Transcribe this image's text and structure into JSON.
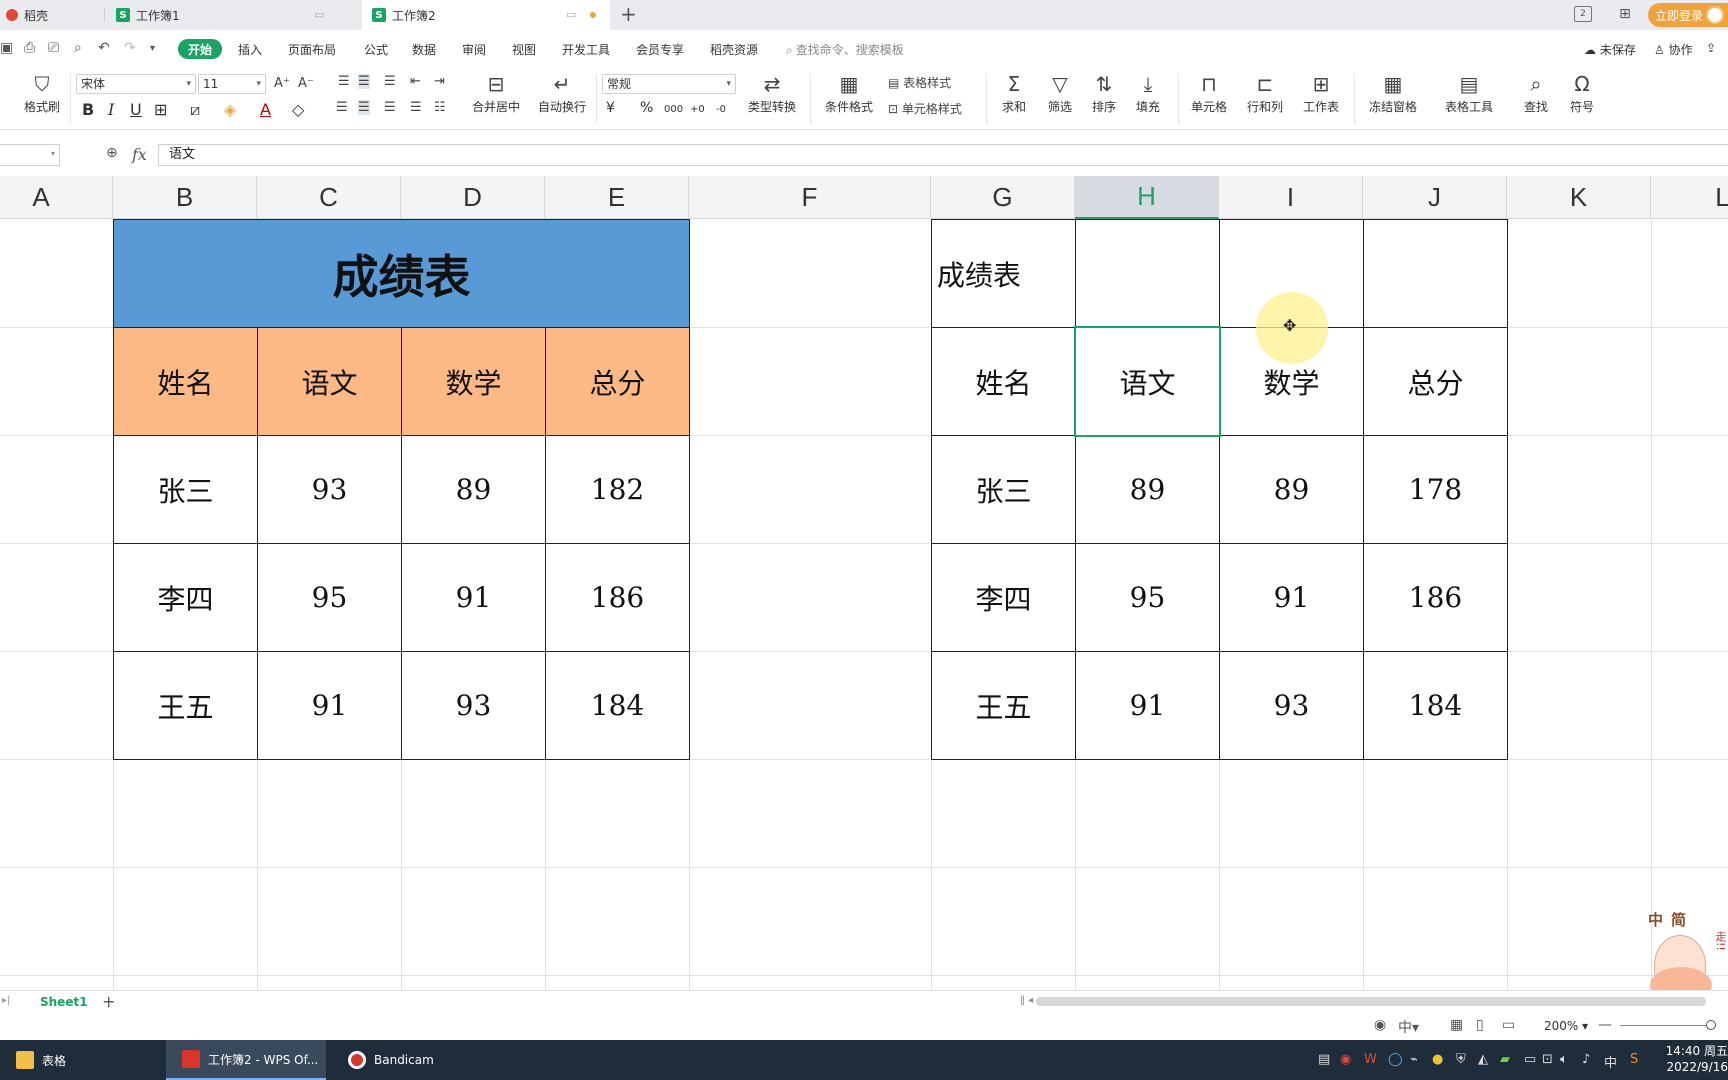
{
  "tabs": [
    {
      "label": "稻壳"
    },
    {
      "label": "工作簿1"
    },
    {
      "label": "工作簿2"
    }
  ],
  "window": {
    "login_label": "立即登录",
    "page_indicator": "2"
  },
  "menu": {
    "start": "开始",
    "items": [
      "插入",
      "页面布局",
      "公式",
      "数据",
      "审阅",
      "视图",
      "开发工具",
      "会员专享",
      "稻壳资源"
    ],
    "search_placeholder": "查找命令、搜索模板",
    "unsaved": "未保存",
    "collaborate": "协作"
  },
  "ribbon": {
    "format_painter": "格式刷",
    "font_name": "宋体",
    "font_size": "11",
    "merge_center": "合并居中",
    "wrap_text": "自动换行",
    "number_format": "常规",
    "type_convert": "类型转换",
    "conditional_format": "条件格式",
    "table_style": "表格样式",
    "cell_style": "单元格样式",
    "sum": "求和",
    "filter": "筛选",
    "sort": "排序",
    "fill": "填充",
    "cells": "单元格",
    "row_col": "行和列",
    "worksheet": "工作表",
    "freeze": "冻结窗格",
    "table_tools": "表格工具",
    "find": "查找",
    "symbol": "符号"
  },
  "formula": {
    "value": "语文"
  },
  "columns": [
    "A",
    "B",
    "C",
    "D",
    "E",
    "F",
    "G",
    "H",
    "I",
    "J",
    "K",
    "L"
  ],
  "selected_column": "H",
  "left_table": {
    "title": "成绩表",
    "headers": [
      "姓名",
      "语文",
      "数学",
      "总分"
    ],
    "rows": [
      [
        "张三",
        "93",
        "89",
        "182"
      ],
      [
        "李四",
        "95",
        "91",
        "186"
      ],
      [
        "王五",
        "91",
        "93",
        "184"
      ]
    ],
    "colors": {
      "title_bg": "#579ad6",
      "header_bg": "#fcb885"
    }
  },
  "right_table": {
    "title": "成绩表",
    "headers": [
      "姓名",
      "语文",
      "数学",
      "总分"
    ],
    "rows": [
      [
        "张三",
        "89",
        "89",
        "178"
      ],
      [
        "李四",
        "95",
        "91",
        "186"
      ],
      [
        "王五",
        "91",
        "93",
        "184"
      ]
    ]
  },
  "mascot": {
    "title": "中简",
    "side": "小心心我们走!!"
  },
  "sheets": {
    "active": "Sheet1"
  },
  "status": {
    "zoom": "200%"
  },
  "taskbar": {
    "items": [
      "表格",
      "工作簿2 - WPS Of...",
      "Bandicam"
    ],
    "time": "14:40 周五",
    "date": "2022/9/16",
    "ime": "中"
  },
  "accent_color": "#1aa363"
}
